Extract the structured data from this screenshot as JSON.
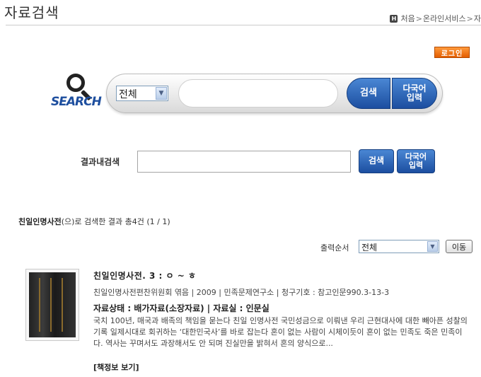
{
  "header": {
    "title": "자료검색",
    "breadcrumb": {
      "home_icon": "H",
      "items": [
        "처음",
        "온라인서비스",
        "자"
      ],
      "separator": ">"
    }
  },
  "login_button": "로그인",
  "search": {
    "logo_text": "SEARCH",
    "scope_value": "전체",
    "query_value": "",
    "search_button": "검색",
    "multilang_button_line1": "다국어",
    "multilang_button_line2": "입력"
  },
  "inner_search": {
    "label": "결과내검색",
    "value": "",
    "search_button": "검색",
    "multilang_button_line1": "다국어",
    "multilang_button_line2": "입력"
  },
  "summary": {
    "keyword": "친일인명사전",
    "text": "(으)로 검색한 결과 총4건 (1 / 1)"
  },
  "sort": {
    "label": "출력순서",
    "value": "전체",
    "move_button": "이동"
  },
  "result": {
    "title": "친일인명사전. 3 : ㅇ ~ ㅎ",
    "meta": "친일인명사전편찬위원회 엮음 | 2009 | 민족문제연구소 | 청구기호 : 참고인문990.3-13-3",
    "status": "자료상태 : 배가자료(소장자료) | 자료실 : 인문실",
    "abstract": "국치 100년, 매국과 배족의 책임을 묻는다 친일 인명사전 국민성금으로 이뤄낸 우리 근현대사에 대한 빼아픈 성찰의 기록 일제시대로 회귀하는 ‘대한민국사’를 바로 잡는다 혼이 없는 사람이 시체이듯이 혼이 없는 민족도 죽은 민족이다. 역사는 꾸며서도 과장해서도 안 되며 진실만을 밝혀서 혼의 양식으로...",
    "detail_link": "[책정보 보기]"
  },
  "colors": {
    "brand_blue": "#1c4ea0",
    "login_orange": "#e35d00"
  }
}
